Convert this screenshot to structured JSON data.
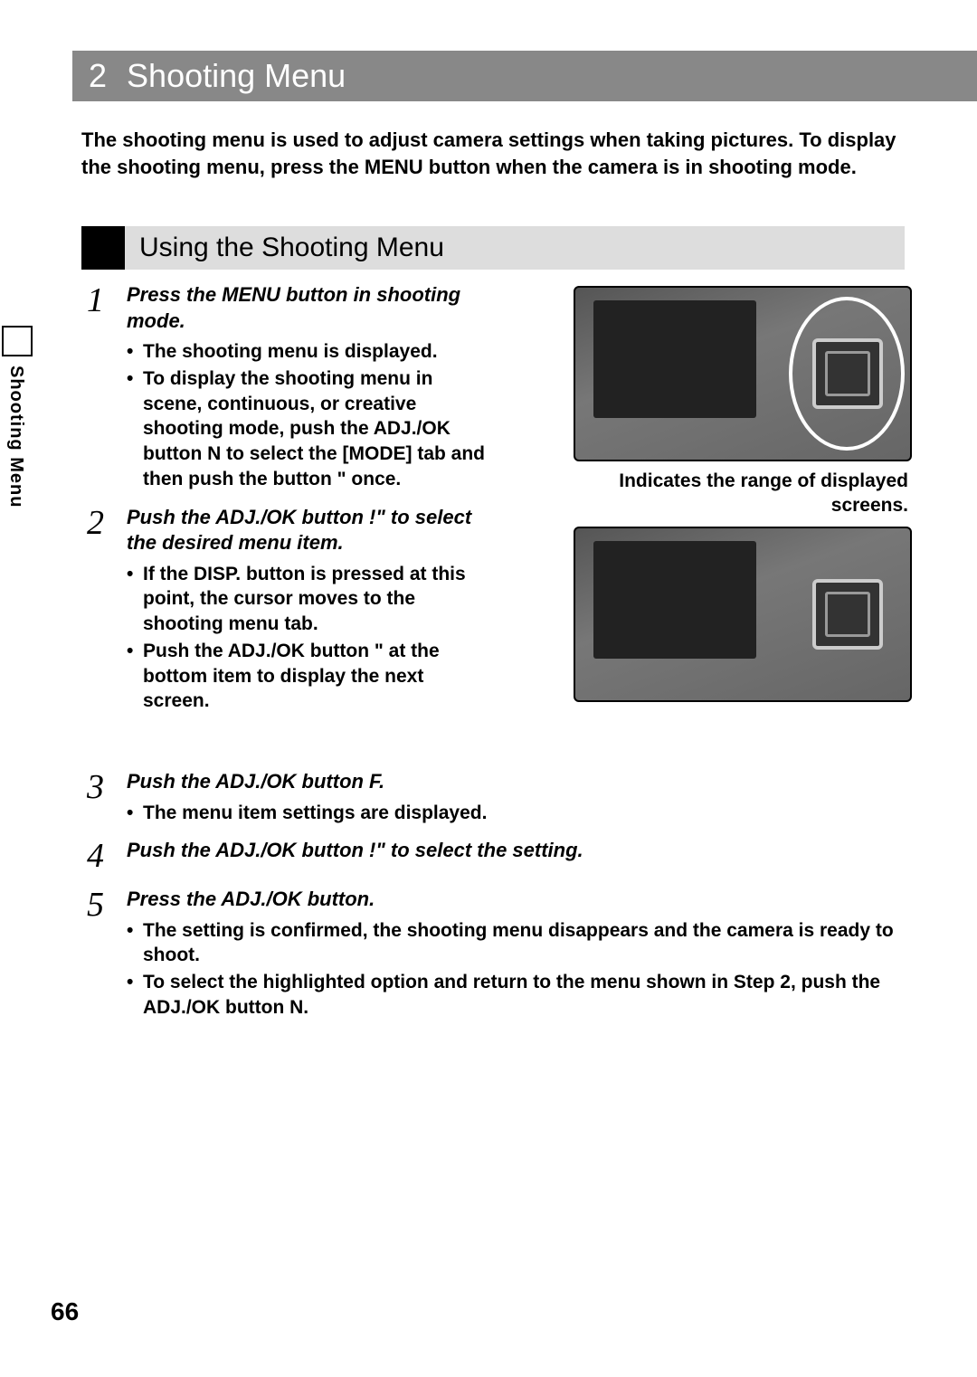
{
  "header": {
    "number": "2",
    "title": "Shooting Menu"
  },
  "intro": "The shooting menu is used to adjust camera settings when taking pictures. To display the shooting menu, press the MENU button when the camera is in shooting mode.",
  "section_title": "Using the Shooting Menu",
  "sidebar_label": "Shooting Menu",
  "page_number": "66",
  "fig1_caption": "Indicates the range of displayed screens.",
  "steps": [
    {
      "num": "1",
      "title": "Press the MENU button in shooting mode.",
      "bullets": [
        "The shooting menu is displayed.",
        "To display the shooting menu in scene, continuous, or creative shooting mode, push the ADJ./OK button N to select the [MODE] tab and then push the button \" once."
      ]
    },
    {
      "num": "2",
      "title": "Push the ADJ./OK button !\" to select the desired menu item.",
      "bullets": [
        "If the DISP. button is pressed at this point, the cursor moves to the shooting menu tab.",
        "Push the ADJ./OK button \" at the bottom item to display the next screen."
      ]
    },
    {
      "num": "3",
      "title": "Push the ADJ./OK button F.",
      "bullets": [
        "The menu item settings are displayed."
      ]
    },
    {
      "num": "4",
      "title": "Push the ADJ./OK button !\" to select the setting.",
      "bullets": []
    },
    {
      "num": "5",
      "title": "Press the ADJ./OK button.",
      "bullets": [
        "The setting is confirmed, the shooting menu disappears and the camera is ready to shoot.",
        "To select the highlighted option and return to the menu shown in Step 2, push the ADJ./OK button N."
      ]
    }
  ]
}
